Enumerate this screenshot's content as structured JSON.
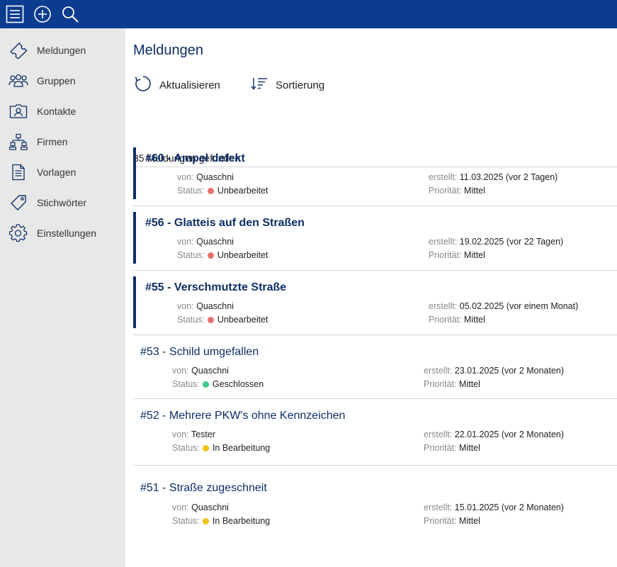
{
  "colors": {
    "brand": "#0b3c8f",
    "title": "#0d2e66",
    "status_open": "#e8706a",
    "status_closed": "#3cc98a",
    "status_progress": "#f0c419"
  },
  "topbar": {
    "icons": [
      "menu-icon",
      "plus-circle-icon",
      "search-icon"
    ]
  },
  "sidebar": {
    "items": [
      {
        "label": "Meldungen",
        "icon": "ticket-icon"
      },
      {
        "label": "Gruppen",
        "icon": "group-icon"
      },
      {
        "label": "Kontakte",
        "icon": "contact-card-icon"
      },
      {
        "label": "Firmen",
        "icon": "org-chart-icon"
      },
      {
        "label": "Vorlagen",
        "icon": "document-icon"
      },
      {
        "label": "Stichwörter",
        "icon": "tag-icon"
      },
      {
        "label": "Einstellungen",
        "icon": "gear-icon"
      }
    ]
  },
  "main": {
    "title": "Meldungen",
    "toolbar": {
      "refresh": "Aktualisieren",
      "sort": "Sortierung"
    },
    "result_count": "35 Meldungen gefunden",
    "labels": {
      "from": "von:",
      "status": "Status:",
      "created": "erstellt:",
      "priority": "Priorität:"
    },
    "reports": [
      {
        "title": "#60 - Ampel defekt",
        "from": "Quaschni",
        "status": "Unbearbeitet",
        "status_color": "#e8706a",
        "created": "11.03.2025 (vor 2 Tagen)",
        "priority": "Mittel",
        "unread": true
      },
      {
        "title": "#56 - Glatteis auf den Straßen",
        "from": "Quaschni",
        "status": "Unbearbeitet",
        "status_color": "#e8706a",
        "created": "19.02.2025 (vor 22 Tagen)",
        "priority": "Mittel",
        "unread": true
      },
      {
        "title": "#55 - Verschmutzte Straße",
        "from": "Quaschni",
        "status": "Unbearbeitet",
        "status_color": "#e8706a",
        "created": "05.02.2025 (vor einem Monat)",
        "priority": "Mittel",
        "unread": true
      },
      {
        "title": "#53 - Schild umgefallen",
        "from": "Quaschni",
        "status": "Geschlossen",
        "status_color": "#3cc98a",
        "created": "23.01.2025 (vor 2 Monaten)",
        "priority": "Mittel",
        "unread": false
      },
      {
        "title": "#52 - Mehrere PKW's ohne Kennzeichen",
        "from": "Tester",
        "status": "In Bearbeitung",
        "status_color": "#f0c419",
        "created": "22.01.2025 (vor 2 Monaten)",
        "priority": "Mittel",
        "unread": false
      },
      {
        "title": "#51 - Straße zugeschneit",
        "from": "Quaschni",
        "status": "In Bearbeitung",
        "status_color": "#f0c419",
        "created": "15.01.2025 (vor 2 Monaten)",
        "priority": "Mittel",
        "unread": false
      }
    ]
  }
}
